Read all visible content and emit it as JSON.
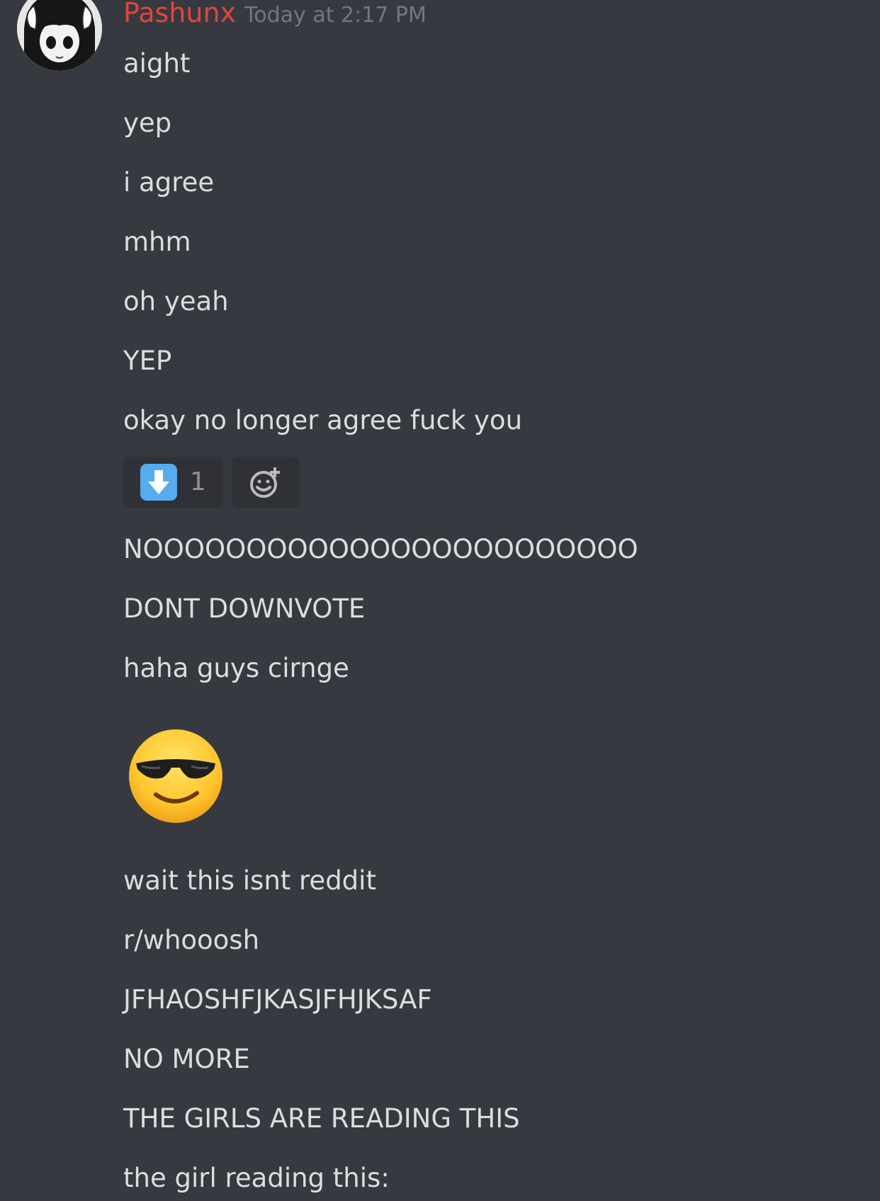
{
  "message": {
    "author": "Pashunx",
    "timestamp": "Today at 2:17 PM",
    "author_color": "#e0453d"
  },
  "lines": [
    "aight",
    "yep",
    "i agree",
    "mhm",
    "oh yeah",
    "YEP",
    "okay no longer agree fuck you",
    "NOOOOOOOOOOOOOOOOOOOOOOOO",
    "DONT DOWNVOTE",
    "haha guys cirnge",
    "wait this isnt reddit",
    "r/whooosh",
    "JFHAOSHFJKASJFHJKSAF",
    "NO MORE",
    "THE GIRLS ARE READING THIS",
    "the girl reading this:"
  ],
  "reactions": [
    {
      "emoji": "down-arrow-emoji",
      "count": "1"
    },
    {
      "emoji": "add-reaction-icon",
      "count": ""
    }
  ],
  "inline_emoji": "smiling-face-with-sunglasses-emoji",
  "colors": {
    "background": "#36393f",
    "text": "#dcddde",
    "timestamp": "#72767d",
    "reaction_bg": "#2f3136",
    "arrow_emoji": "#55acee"
  }
}
